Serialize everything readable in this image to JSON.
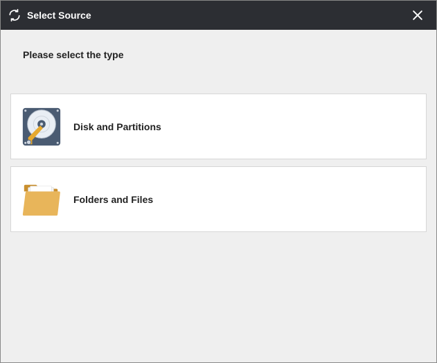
{
  "titlebar": {
    "title": "Select Source"
  },
  "content": {
    "prompt": "Please select the type"
  },
  "options": [
    {
      "label": "Disk and Partitions"
    },
    {
      "label": "Folders and Files"
    }
  ]
}
